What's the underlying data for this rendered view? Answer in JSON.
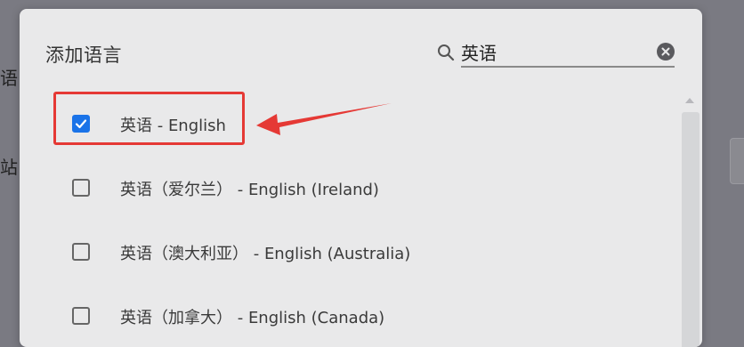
{
  "background": {
    "fragment_1": "语",
    "fragment_2": "站"
  },
  "dialog": {
    "title": "添加语言",
    "search": {
      "value": "英语",
      "placeholder": ""
    },
    "languages": [
      {
        "label": "英语 - English",
        "checked": true
      },
      {
        "label": "英语（爱尔兰） - English (Ireland)",
        "checked": false
      },
      {
        "label": "英语（澳大利亚） - English (Australia)",
        "checked": false
      },
      {
        "label": "英语（加拿大） - English (Canada)",
        "checked": false
      }
    ]
  },
  "colors": {
    "accent": "#1a73e8",
    "annotation": "#e53935",
    "overlay": "#7a7a82",
    "dialog_bg": "#e9e9ea"
  },
  "icons": {
    "search": "search-icon",
    "clear": "clear-icon",
    "check": "check-icon"
  }
}
